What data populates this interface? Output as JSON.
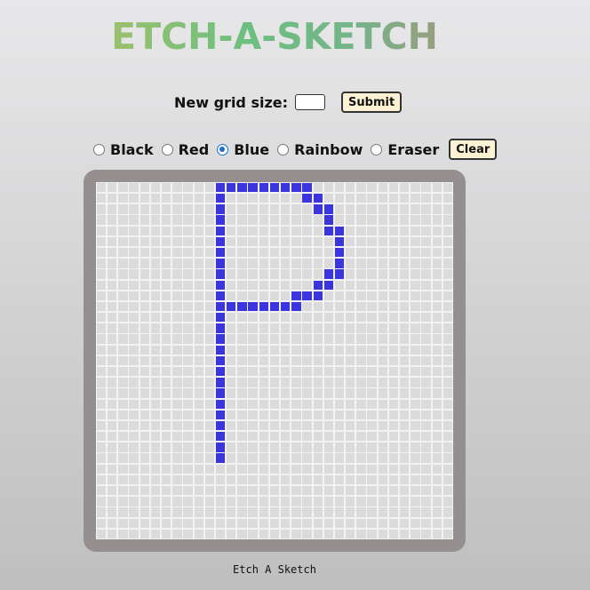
{
  "header": {
    "title": "ETCH-A-SKETCH"
  },
  "grid_size_form": {
    "label": "New grid size:",
    "input_value": "",
    "submit_label": "Submit"
  },
  "modes": {
    "options": [
      {
        "label": "Black",
        "checked": false
      },
      {
        "label": "Red",
        "checked": false
      },
      {
        "label": "Blue",
        "checked": true
      },
      {
        "label": "Rainbow",
        "checked": false
      },
      {
        "label": "Eraser",
        "checked": false
      }
    ],
    "clear_label": "Clear"
  },
  "sketch": {
    "grid_size": 33,
    "empty_color": "#dcdbdb",
    "line_color": "#f2f2f2",
    "ink_color": "#3b35e0",
    "frame_color": "#968f8f",
    "drawn_cells": [
      [
        0,
        11
      ],
      [
        0,
        12
      ],
      [
        0,
        13
      ],
      [
        0,
        14
      ],
      [
        0,
        15
      ],
      [
        0,
        16
      ],
      [
        0,
        17
      ],
      [
        0,
        18
      ],
      [
        0,
        19
      ],
      [
        1,
        11
      ],
      [
        1,
        19
      ],
      [
        1,
        20
      ],
      [
        2,
        11
      ],
      [
        2,
        20
      ],
      [
        2,
        21
      ],
      [
        3,
        11
      ],
      [
        3,
        21
      ],
      [
        4,
        11
      ],
      [
        4,
        21
      ],
      [
        4,
        22
      ],
      [
        5,
        11
      ],
      [
        5,
        22
      ],
      [
        6,
        11
      ],
      [
        6,
        22
      ],
      [
        7,
        11
      ],
      [
        7,
        22
      ],
      [
        8,
        11
      ],
      [
        8,
        21
      ],
      [
        8,
        22
      ],
      [
        9,
        11
      ],
      [
        9,
        20
      ],
      [
        9,
        21
      ],
      [
        10,
        11
      ],
      [
        10,
        18
      ],
      [
        10,
        19
      ],
      [
        10,
        20
      ],
      [
        11,
        11
      ],
      [
        11,
        12
      ],
      [
        11,
        13
      ],
      [
        11,
        14
      ],
      [
        11,
        15
      ],
      [
        11,
        16
      ],
      [
        11,
        17
      ],
      [
        11,
        18
      ],
      [
        12,
        11
      ],
      [
        13,
        11
      ],
      [
        14,
        11
      ],
      [
        15,
        11
      ],
      [
        16,
        11
      ],
      [
        17,
        11
      ],
      [
        18,
        11
      ],
      [
        19,
        11
      ],
      [
        20,
        11
      ],
      [
        21,
        11
      ],
      [
        22,
        11
      ],
      [
        23,
        11
      ],
      [
        24,
        11
      ],
      [
        25,
        11
      ]
    ]
  },
  "footer": {
    "text": "Etch A Sketch"
  }
}
